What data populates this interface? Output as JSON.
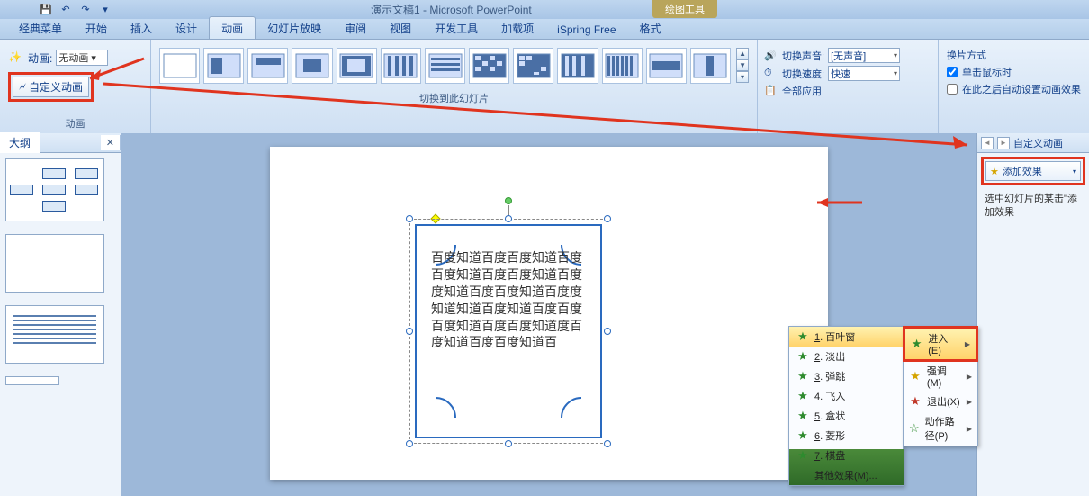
{
  "title": "演示文稿1 - Microsoft PowerPoint",
  "contextual_tab": "绘图工具",
  "tabs": [
    "经典菜单",
    "开始",
    "插入",
    "设计",
    "动画",
    "幻灯片放映",
    "审阅",
    "视图",
    "开发工具",
    "加载项",
    "iSpring Free",
    "格式"
  ],
  "active_tab_index": 4,
  "anim_group": {
    "dropdown_label": "动画:",
    "dropdown_value": "无动画",
    "custom_button": "自定义动画",
    "section_label": "动画"
  },
  "transition_section_label": "切换到此幻灯片",
  "trans_opts": {
    "sound_label": "切换声音:",
    "sound_value": "[无声音]",
    "speed_label": "切换速度:",
    "speed_value": "快速",
    "apply_all": "全部应用"
  },
  "advance": {
    "heading": "换片方式",
    "on_click": "单击鼠标时",
    "auto_after": "在此之后自动设置动画效果"
  },
  "outline_tab": "大纲",
  "shape_text": "百度知道百度百度知道百度百度知道百度百度知道百度度知道百度百度知道百度度知道知道百度知道百度百度百度知道百度百度知道度百度知道百度百度知道百",
  "taskpane": {
    "title": "自定义动画",
    "add_effect": "添加效果",
    "hint": "选中幻灯片的某击\"添加效果"
  },
  "submenu": [
    {
      "label": "进入(E)",
      "hover": true
    },
    {
      "label": "强调(M)",
      "star": "y"
    },
    {
      "label": "退出(X)",
      "star": "r"
    },
    {
      "label": "动作路径(P)",
      "star": "g"
    }
  ],
  "fxlist": [
    {
      "n": "1",
      "label": "百叶窗",
      "hover": true
    },
    {
      "n": "2",
      "label": "淡出"
    },
    {
      "n": "3",
      "label": "弹跳"
    },
    {
      "n": "4",
      "label": "飞入"
    },
    {
      "n": "5",
      "label": "盒状"
    },
    {
      "n": "6",
      "label": "菱形"
    },
    {
      "n": "7",
      "label": "棋盘"
    }
  ],
  "fx_more": "其他效果(M)..."
}
